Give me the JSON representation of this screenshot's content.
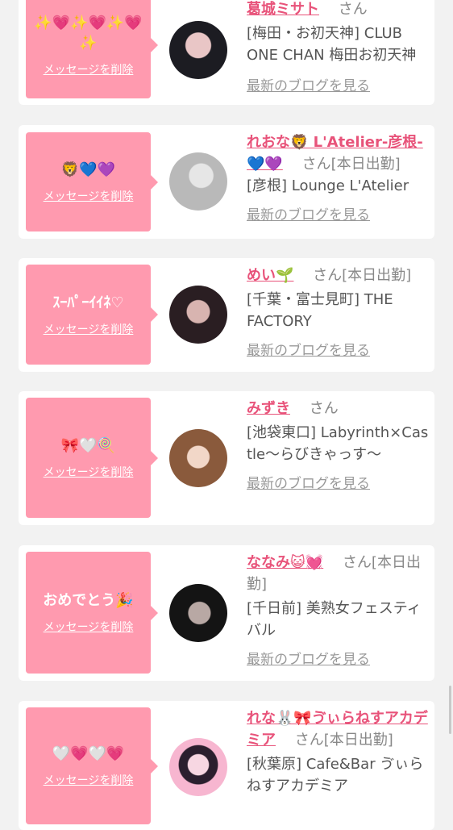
{
  "delete_label": "メッセージを削除",
  "blog_label": "最新のブログを見る",
  "san_label": "さん",
  "cards": [
    {
      "message": "✨💗✨💗✨💗✨",
      "name": "葛城ミサト",
      "status": "",
      "shop": "[梅田・お初天神] CLUB ONE CHAN 梅田お初天神",
      "avatar_colors": [
        "#1c1c22",
        "#e9c6c6"
      ]
    },
    {
      "message": "🦁💙💜",
      "name": "れおな🦁 L'Atelier-彦根-💙💜",
      "status": "[本日出勤]",
      "shop": "[彦根] Lounge L'Atelier",
      "avatar_colors": [
        "#b9b9b9",
        "#e6e6e6"
      ]
    },
    {
      "message": "ｽｰﾊﾟｰｲｲﾈ♡",
      "name": "めい🌱",
      "status": "[本日出勤]",
      "shop": "[千葉・富士見町] THE FACTORY",
      "avatar_colors": [
        "#2a1e22",
        "#d8b4b0"
      ]
    },
    {
      "message": "🎀🤍🍭",
      "name": "みずき",
      "status": "",
      "shop": "[池袋東口] Labyrinth×Castle〜らびきゃっす〜",
      "avatar_colors": [
        "#8a5a3c",
        "#f2d7c8"
      ]
    },
    {
      "message": "おめでとう🎉",
      "name": "ななみ😺💓",
      "status": "[本日出勤]",
      "shop": "[千日前] 美熟女フェスティバル",
      "avatar_colors": [
        "#141414",
        "#b8a8a4"
      ]
    },
    {
      "message": "🤍💗🤍💗",
      "name": "れな🐰🎀ゔぃらねすアカデミア",
      "status": "[本日出勤]",
      "shop": "[秋葉原] Cafe&Bar ゔぃらねすアカデミア",
      "avatar_colors": [
        "#f7b6d0",
        "#2b1f2e"
      ]
    }
  ]
}
